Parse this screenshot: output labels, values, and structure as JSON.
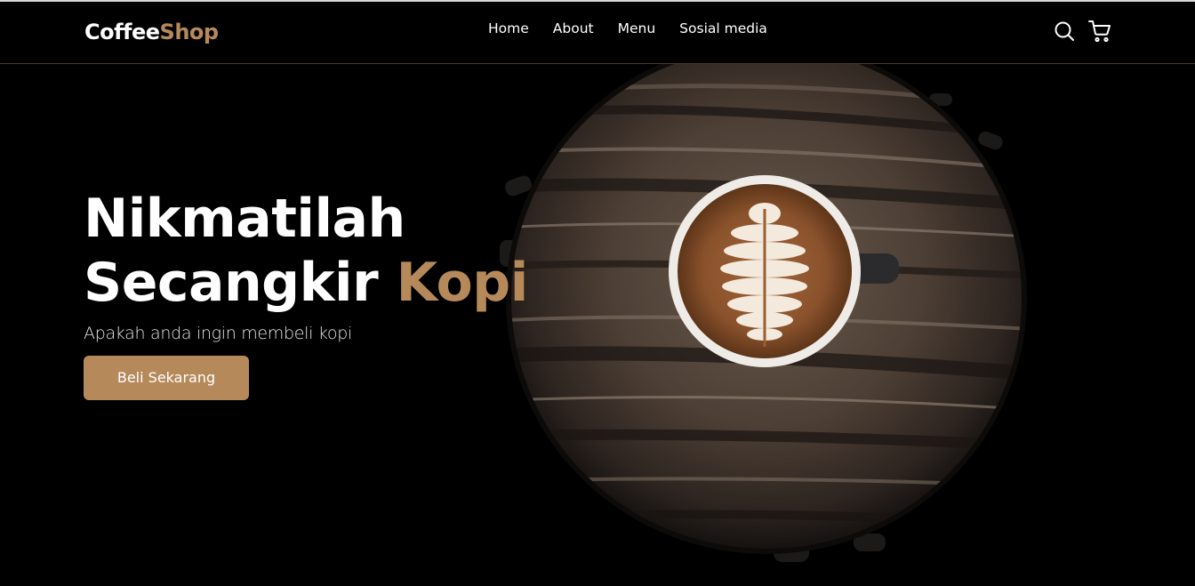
{
  "brand": {
    "name_part1": "Coffee",
    "name_part2": "Shop"
  },
  "nav": {
    "links": [
      "Home",
      "About",
      "Menu",
      "Sosial media"
    ],
    "icons": [
      "search-icon",
      "cart-icon"
    ]
  },
  "hero": {
    "title_line1": "Nikmatilah",
    "title_line2_prefix": "Secangkir ",
    "title_line2_accent": "Kopi",
    "subtitle": "Apakah anda ingin membeli kopi",
    "cta_label": "Beli Sekarang"
  },
  "colors": {
    "accent": "#b6895b",
    "background": "#000000",
    "text": "#ffffff"
  }
}
